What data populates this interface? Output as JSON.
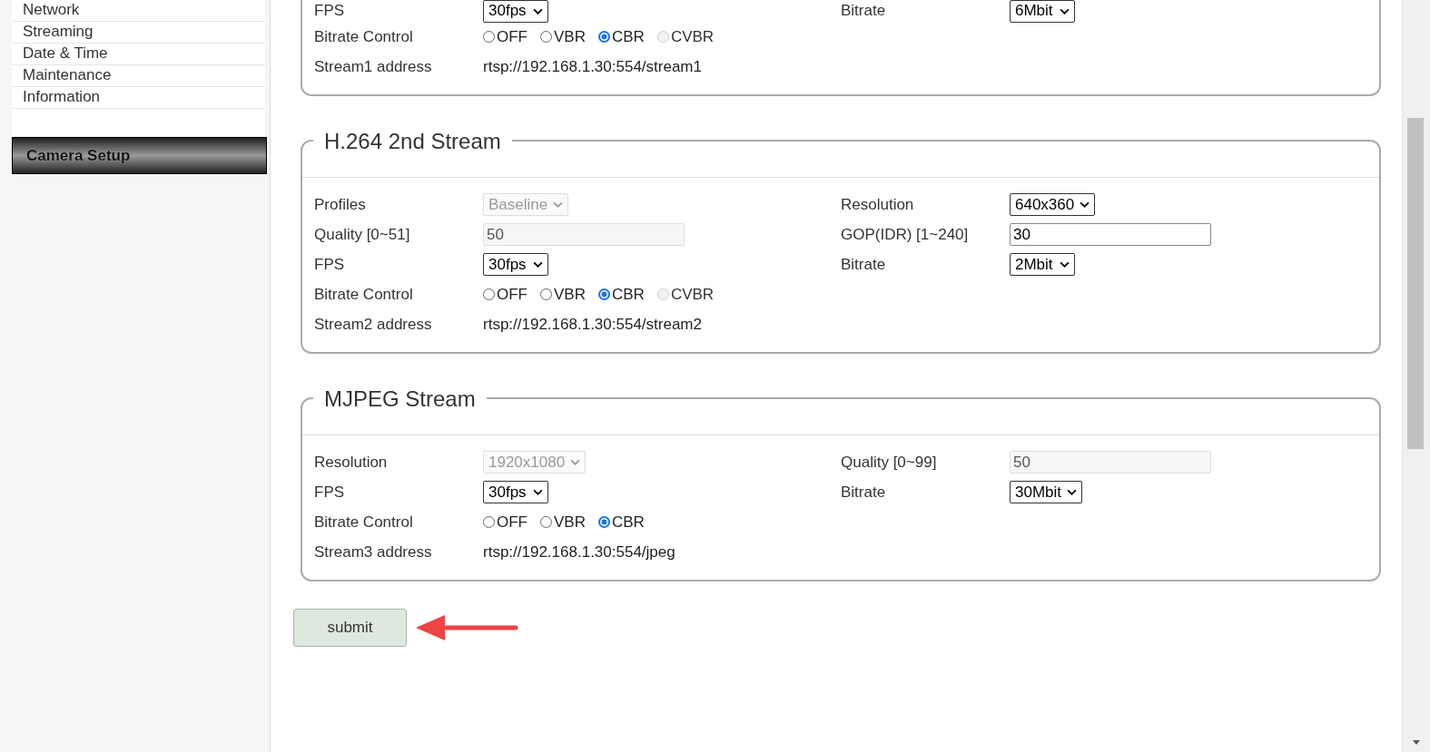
{
  "sidebar": {
    "items": [
      {
        "label": "Network"
      },
      {
        "label": "Streaming"
      },
      {
        "label": "Date & Time"
      },
      {
        "label": "Maintenance"
      },
      {
        "label": "Information"
      }
    ],
    "section_button": "Camera Setup"
  },
  "sections": [
    {
      "rows": [
        {
          "left": {
            "label": "FPS",
            "kind": "select",
            "value": "30fps",
            "disabled": false
          },
          "right": {
            "label": "Bitrate",
            "kind": "select",
            "value": "6Mbit",
            "disabled": false
          }
        },
        {
          "left": {
            "label": "Bitrate Control",
            "kind": "radios",
            "options": [
              {
                "label": "OFF",
                "selected": false,
                "disabled": false
              },
              {
                "label": "VBR",
                "selected": false,
                "disabled": false
              },
              {
                "label": "CBR",
                "selected": true,
                "disabled": false
              },
              {
                "label": "CVBR",
                "selected": false,
                "disabled": true
              }
            ]
          }
        },
        {
          "left": {
            "label": "Stream1 address",
            "kind": "text",
            "value": "rtsp://192.168.1.30:554/stream1"
          }
        }
      ]
    },
    {
      "title": "H.264 2nd Stream",
      "rows": [
        {
          "left": {
            "label": "Profiles",
            "kind": "select",
            "value": "Baseline",
            "disabled": true
          },
          "right": {
            "label": "Resolution",
            "kind": "select",
            "value": "640x360",
            "disabled": false
          }
        },
        {
          "left": {
            "label": "Quality [0~51]",
            "kind": "input",
            "value": "50",
            "disabled": true
          },
          "right": {
            "label": "GOP(IDR) [1~240]",
            "kind": "input",
            "value": "30",
            "disabled": false
          }
        },
        {
          "left": {
            "label": "FPS",
            "kind": "select",
            "value": "30fps",
            "disabled": false
          },
          "right": {
            "label": "Bitrate",
            "kind": "select",
            "value": "2Mbit",
            "disabled": false
          }
        },
        {
          "left": {
            "label": "Bitrate Control",
            "kind": "radios",
            "options": [
              {
                "label": "OFF",
                "selected": false,
                "disabled": false
              },
              {
                "label": "VBR",
                "selected": false,
                "disabled": false
              },
              {
                "label": "CBR",
                "selected": true,
                "disabled": false
              },
              {
                "label": "CVBR",
                "selected": false,
                "disabled": true
              }
            ]
          }
        },
        {
          "left": {
            "label": "Stream2 address",
            "kind": "text",
            "value": "rtsp://192.168.1.30:554/stream2"
          }
        }
      ]
    },
    {
      "title": "MJPEG Stream",
      "rows": [
        {
          "left": {
            "label": "Resolution",
            "kind": "select",
            "value": "1920x1080",
            "disabled": true
          },
          "right": {
            "label": "Quality [0~99]",
            "kind": "input",
            "value": "50",
            "disabled": true
          }
        },
        {
          "left": {
            "label": "FPS",
            "kind": "select",
            "value": "30fps",
            "disabled": false
          },
          "right": {
            "label": "Bitrate",
            "kind": "select",
            "value": "30Mbit",
            "disabled": false
          }
        },
        {
          "left": {
            "label": "Bitrate Control",
            "kind": "radios",
            "options": [
              {
                "label": "OFF",
                "selected": false,
                "disabled": false
              },
              {
                "label": "VBR",
                "selected": false,
                "disabled": false
              },
              {
                "label": "CBR",
                "selected": true,
                "disabled": false
              }
            ]
          }
        },
        {
          "left": {
            "label": "Stream3 address",
            "kind": "text",
            "value": "rtsp://192.168.1.30:554/jpeg"
          }
        }
      ]
    }
  ],
  "submit": "submit"
}
